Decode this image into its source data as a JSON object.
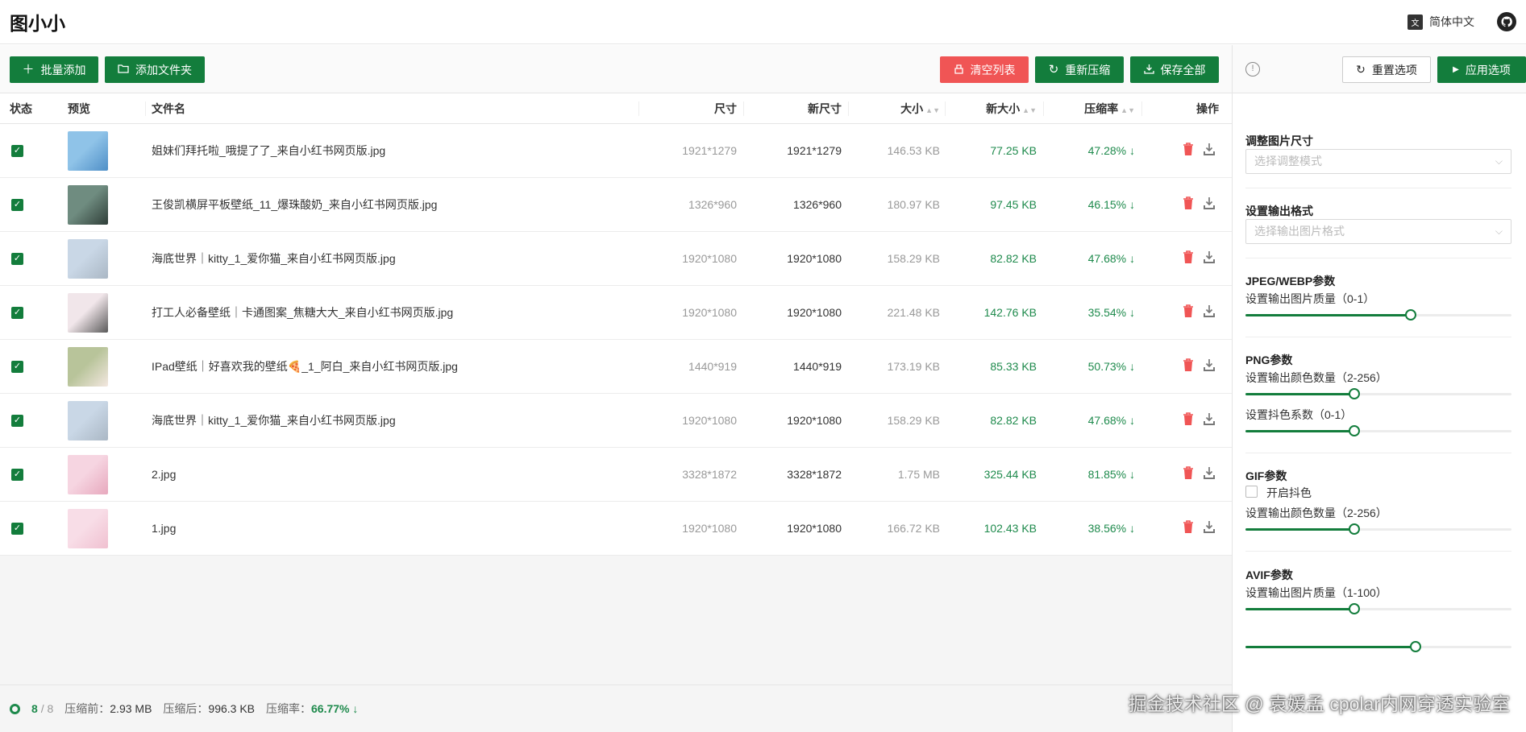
{
  "app": {
    "title": "图小小",
    "language": "简体中文"
  },
  "toolbar": {
    "batch_add": "批量添加",
    "add_folder": "添加文件夹",
    "clear_list": "清空列表",
    "recompress": "重新压缩",
    "save_all": "保存全部"
  },
  "table": {
    "headers": {
      "status": "状态",
      "preview": "预览",
      "filename": "文件名",
      "size": "尺寸",
      "new_size": "新尺寸",
      "bytes": "大小",
      "new_bytes": "新大小",
      "ratio": "压缩率",
      "actions": "操作"
    },
    "rows": [
      {
        "name": "姐妹们拜托啦_哦提了了_来自小红书网页版.jpg",
        "size": "1921*1279",
        "new_size": "1921*1279",
        "bytes": "146.53 KB",
        "new_bytes": "77.25 KB",
        "ratio": "47.28%"
      },
      {
        "name": "王俊凯横屏平板壁纸_11_爆珠酸奶_来自小红书网页版.jpg",
        "size": "1326*960",
        "new_size": "1326*960",
        "bytes": "180.97 KB",
        "new_bytes": "97.45 KB",
        "ratio": "46.15%"
      },
      {
        "name": "海底世界｜kitty_1_爱你猫_来自小红书网页版.jpg",
        "size": "1920*1080",
        "new_size": "1920*1080",
        "bytes": "158.29 KB",
        "new_bytes": "82.82 KB",
        "ratio": "47.68%"
      },
      {
        "name": "打工人必备壁纸｜卡通图案_焦糖大大_来自小红书网页版.jpg",
        "size": "1920*1080",
        "new_size": "1920*1080",
        "bytes": "221.48 KB",
        "new_bytes": "142.76 KB",
        "ratio": "35.54%"
      },
      {
        "name": "IPad壁纸｜好喜欢我的壁纸🍕_1_阿白_来自小红书网页版.jpg",
        "size": "1440*919",
        "new_size": "1440*919",
        "bytes": "173.19 KB",
        "new_bytes": "85.33 KB",
        "ratio": "50.73%"
      },
      {
        "name": "海底世界｜kitty_1_爱你猫_来自小红书网页版.jpg",
        "size": "1920*1080",
        "new_size": "1920*1080",
        "bytes": "158.29 KB",
        "new_bytes": "82.82 KB",
        "ratio": "47.68%"
      },
      {
        "name": "2.jpg",
        "size": "3328*1872",
        "new_size": "3328*1872",
        "bytes": "1.75 MB",
        "new_bytes": "325.44 KB",
        "ratio": "81.85%"
      },
      {
        "name": "1.jpg",
        "size": "1920*1080",
        "new_size": "1920*1080",
        "bytes": "166.72 KB",
        "new_bytes": "102.43 KB",
        "ratio": "38.56%"
      }
    ]
  },
  "footer": {
    "done": "8",
    "total": "/ 8",
    "before_label": "压缩前：",
    "before": "2.93 MB",
    "after_label": "压缩后：",
    "after": "996.3 KB",
    "ratio_label": "压缩率：",
    "ratio": "66.77%"
  },
  "panel": {
    "reset": "重置选项",
    "apply": "应用选项",
    "resize_title": "调整图片尺寸",
    "resize_placeholder": "选择调整模式",
    "format_title": "设置输出格式",
    "format_placeholder": "选择输出图片格式",
    "jpeg_title": "JPEG/WEBP参数",
    "jpeg_quality_label": "设置输出图片质量（0-1）",
    "jpeg_quality_level": 0.62,
    "png_title": "PNG参数",
    "png_colors_label": "设置输出颜色数量（2-256）",
    "png_colors_level": 0.41,
    "png_dither_label": "设置抖色系数（0-1）",
    "png_dither_level": 0.41,
    "gif_title": "GIF参数",
    "gif_dither_label": "开启抖色",
    "gif_colors_label": "设置输出颜色数量（2-256）",
    "gif_colors_level": 0.41,
    "avif_title": "AVIF参数",
    "avif_quality_label": "设置输出图片质量（1-100）",
    "avif_quality_level": 0.41,
    "avif_speed_level": 0.64
  },
  "watermark": "掘金技术社区 @ 袁媛孟 cpolar内网穿透实验室",
  "colors": {
    "primary": "#137d3c",
    "danger": "#f05555",
    "accent_green": "#1e8a4c"
  },
  "icons": [
    "plus-icon",
    "folder-icon",
    "clear-icon",
    "refresh-icon",
    "download-icon",
    "trash-icon",
    "play-icon",
    "info-icon",
    "translate-icon",
    "github-icon",
    "check-icon",
    "down-arrow-icon",
    "chevron-down-icon"
  ]
}
